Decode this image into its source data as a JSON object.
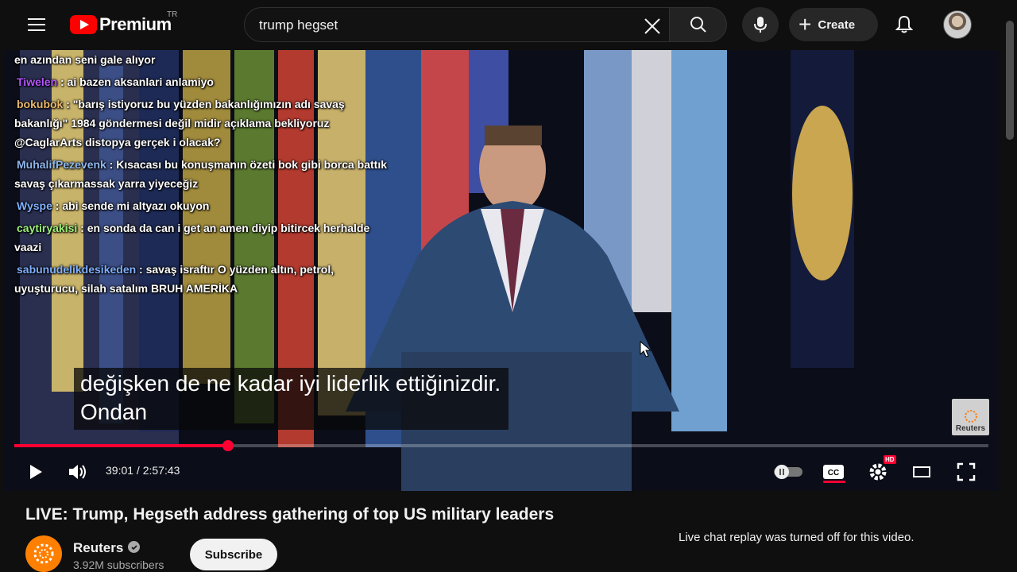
{
  "header": {
    "logo_text": "Premium",
    "country_code": "TR",
    "search_value": "trump hegset",
    "create_label": "Create"
  },
  "chat": [
    {
      "user": "",
      "text": "en azından seni gale alıyor",
      "color": "#ffffff"
    },
    {
      "user": "Tiwelen",
      "text": " : ai bazen aksanlari anlamiyo",
      "color": "#b455ff"
    },
    {
      "user": "bokubok",
      "text": " : \"barış istiyoruz bu yüzden bakanlığımızın adı savaş bakanlığı\" 1984 göndermesi değil midir açıklama bekliyoruz @CaglarArts distopya gerçek i olacak?",
      "color": "#e8b86a"
    },
    {
      "user": "MuhalifPezevenk",
      "text": " : Kısacası bu konuşmanın özeti bok gibi borca battık savaş çıkarmassak yarra yiyeceğiz",
      "color": "#8fb8ef"
    },
    {
      "user": "Wyspe",
      "text": " : abi sende mi altyazı okuyon",
      "color": "#7fb0ff"
    },
    {
      "user": "caytiryakisi",
      "text": " : en sonda da can i get an amen diyip bitircek herhalde vaazi",
      "color": "#9cf07a"
    },
    {
      "user": "sabunudelikdesikeden",
      "text": " : savaş israftır O yüzden altın, petrol, uyuşturucu, silah satalım BRUH AMERİKA",
      "color": "#7fb0ff"
    }
  ],
  "subtitle": {
    "line1": "değişken de ne kadar iyi liderlik ettiğinizdir.",
    "line2": "Ondan"
  },
  "watermark": "Reuters",
  "player": {
    "current_time": "39:01",
    "duration": "2:57:43",
    "time_display": "39:01 / 2:57:43",
    "progress_fraction": 0.2195,
    "hd_label": "HD",
    "cc_label": "CC"
  },
  "video": {
    "title": "LIVE: Trump, Hegseth address gathering of top US military leaders",
    "channel_name": "Reuters",
    "subscribers": "3.92M subscribers",
    "subscribe_label": "Subscribe",
    "chat_notice": "Live chat replay was turned off for this video."
  },
  "icons": [
    "menu-icon",
    "youtube-logo-icon",
    "clear-icon",
    "search-icon",
    "mic-icon",
    "plus-icon",
    "bell-icon",
    "play-icon",
    "volume-icon",
    "autoplay-toggle-icon",
    "cc-icon",
    "settings-icon",
    "theater-icon",
    "fullscreen-icon",
    "verified-icon"
  ],
  "colors": {
    "accent": "#ff0033",
    "brand": "#ff0000",
    "background": "#0f0f0f"
  }
}
